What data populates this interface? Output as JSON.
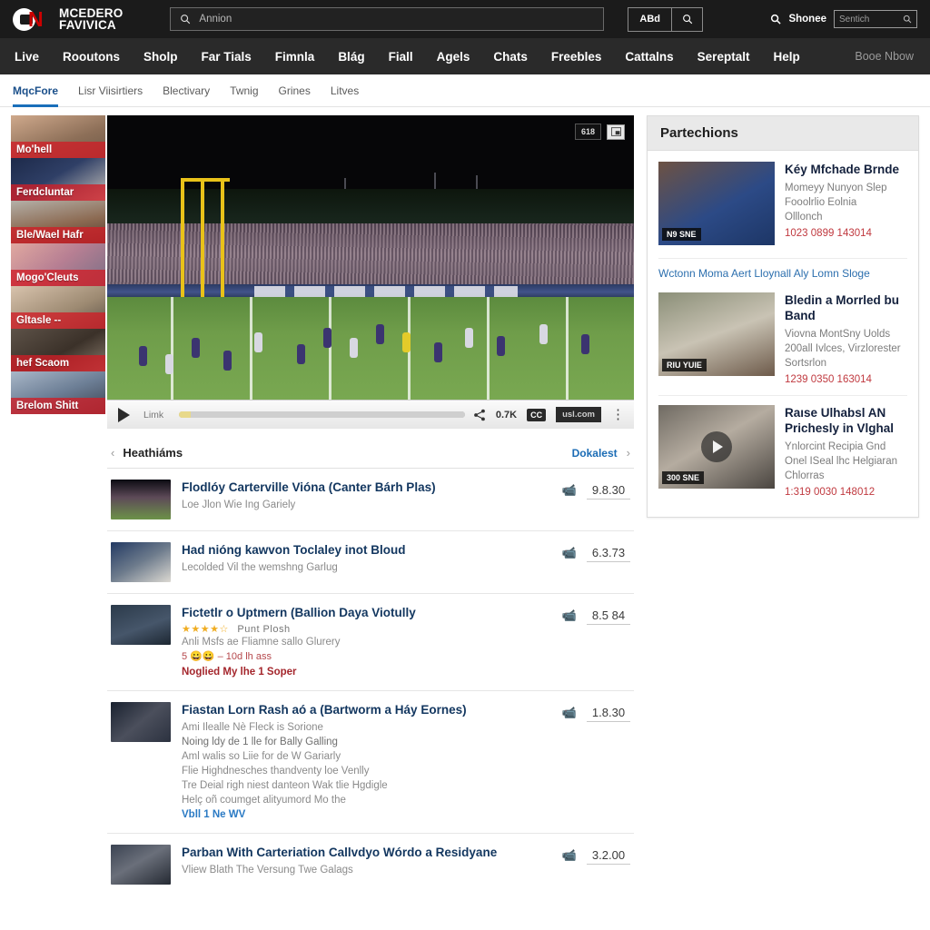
{
  "header": {
    "logo_text_line1": "MCEDERO",
    "logo_text_line2": "FAVIVICA",
    "logo_mark": "cn-logo-icon",
    "search_placeholder": "Annion",
    "search_value": "",
    "button_label": "ABd",
    "search_icon": "search-icon",
    "right_label": "Shonee",
    "mini_search_placeholder": "Sentich"
  },
  "mainnav": {
    "items": [
      "Live",
      "Rooutons",
      "Sholp",
      "Far Tials",
      "Fimnla",
      "Blág",
      "Fiall",
      "Agels",
      "Chats",
      "Freebles",
      "Cattalns",
      "Sereptalt",
      "Help"
    ],
    "right_label": "Booe Nbow"
  },
  "subnav": {
    "tabs": [
      {
        "label": "MqcFore",
        "active": true
      },
      {
        "label": "Lisr Viisirtiers",
        "active": false
      },
      {
        "label": "Blectivary",
        "active": false
      },
      {
        "label": "Twnig",
        "active": false
      },
      {
        "label": "Grines",
        "active": false
      },
      {
        "label": "Litves",
        "active": false
      }
    ]
  },
  "rail": {
    "items": [
      {
        "caption": "Mo'hell"
      },
      {
        "caption": "Ferdcluntar"
      },
      {
        "caption": "Ble/Wael Hafr"
      },
      {
        "caption": "Mogo'Cleuts"
      },
      {
        "caption": "Gltasle --"
      },
      {
        "caption": "hef Scaom"
      },
      {
        "caption": "Brelom Shitt"
      }
    ]
  },
  "player": {
    "badge_text": "618",
    "badge_icon": "picture-in-picture-icon",
    "play_icon": "play-icon",
    "time_label": "Limk",
    "progress_percent": 4,
    "share_icon": "share-icon",
    "share_count": "0.7K",
    "cc_label": "CC",
    "brand_label": "usl.com",
    "menu_icon": "kebab-menu-icon"
  },
  "section": {
    "back_icon": "chevron-left-icon",
    "title": "Heathiáms",
    "more_label": "Dokalest",
    "next_icon": "chevron-right-icon"
  },
  "list": [
    {
      "title": "Flodlóy Carterville Vióna (Canter Bárh Plas)",
      "lines": [
        "Loe Jlon Wie Ing Gariely"
      ],
      "score": "9.8.30",
      "icon": "video-icon"
    },
    {
      "title": "Had nióng kawvon Toclaley inot Bloud",
      "lines": [
        "Lecolded Vil the wemshng Garlug"
      ],
      "score": "6.3.73",
      "icon": "video-icon"
    },
    {
      "title": "Fictetlr o Uptmern (Ballion Daya Viotully",
      "stars": "★★★★☆",
      "stars_label": "Punt Plosh",
      "lines": [
        "Anli Msfs ae Fliamne sallo Glurery"
      ],
      "emoji_line": "5 😀😀 – 10d lh ass",
      "red_line": "Noglied My lhe 1 Soper",
      "score": "8.5 84",
      "icon": "video-icon"
    },
    {
      "title": "Fiastan Lorn Rash aó a (Bartworm a Háy Eornes)",
      "lines": [
        "Ami Ilealle Nè Fleck is Sorione",
        "Noing ldy de 1 lle for Bally Galling",
        "Aml walis so Liie for de W Gariarly",
        "Flie Highdnesches thandventy loe Venlly",
        "Tre Deial righ niest danteon Wak tlie Hgdigle",
        "Helç oñ coumget alityumord Mo the"
      ],
      "link_line": "Vbll 1 Ne WV",
      "score": "1.8.30",
      "icon": "video-icon"
    },
    {
      "title": "Parban With Carteriation Callvdyo Wórdo a Residyane",
      "lines": [
        "Vliew Blath The Versung Twe Galags"
      ],
      "score": "3.2.00",
      "icon": "video-icon"
    }
  ],
  "panel": {
    "title": "Partechions",
    "items": [
      {
        "tag": "N9 SNE",
        "title": "Kéy Mfchade Brnde",
        "desc": [
          "Momeyy Nunyon Slep",
          "Fooolrlio Eolnia",
          "Olllonch"
        ],
        "meta": "1023 0899 143014",
        "has_play": false
      },
      {
        "tag": "RIU YUIE",
        "title": "Bledin a Morrled bu Band",
        "desc": [
          "Viovna MontSny Uolds",
          "200all Ivlces, Virzlorester",
          "Sortsrlon"
        ],
        "meta": "1239 0350 163014",
        "has_play": false
      },
      {
        "tag": "300 SNE",
        "title": "Raıse Ulhabsl AN Prichesly in Vlghal",
        "desc": [
          "Ynlorcint Recipia Gnd",
          "Onel ISeal lhc Helgiaran",
          "Chlorras"
        ],
        "meta": "1:319 0030 148012",
        "has_play": true
      }
    ],
    "link": "Wctonn Moma Aert Lloynall Aly Lomn Sloge"
  },
  "colors": {
    "brand_red": "#cc0000",
    "topbar": "#1b1b1b",
    "nav": "#2a2a2a",
    "link_blue": "#1b6cb5",
    "title_blue": "#12365f",
    "rail_overlay": "#d01e26"
  }
}
